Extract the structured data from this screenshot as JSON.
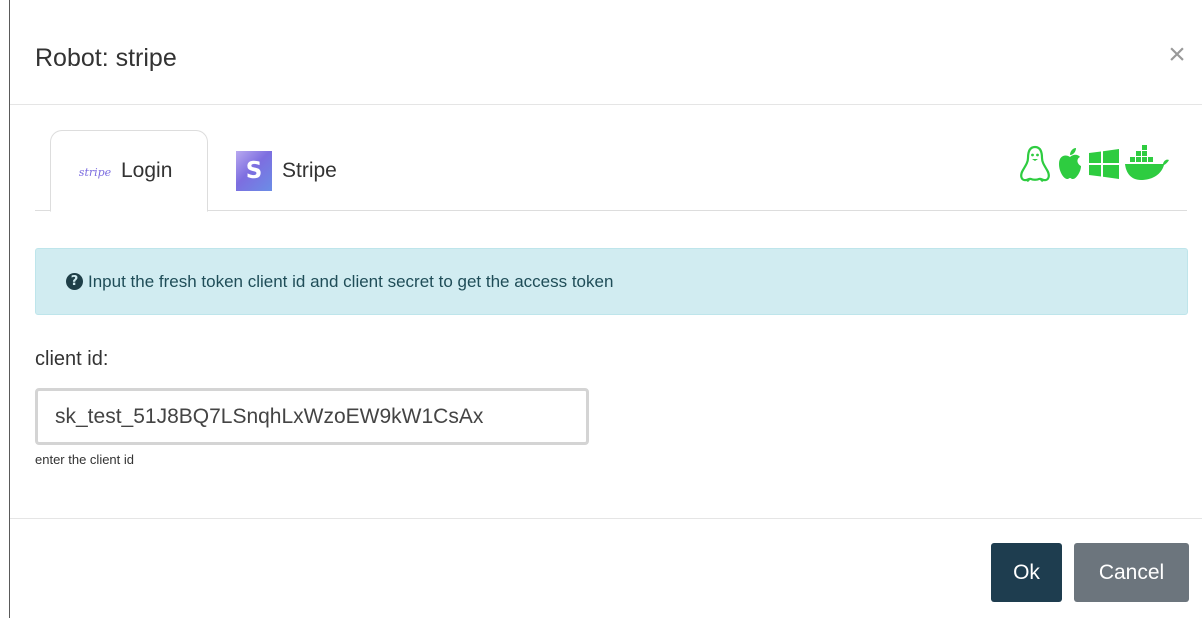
{
  "dialog": {
    "title": "Robot: stripe"
  },
  "tabs": [
    {
      "label": "Login",
      "icon": "stripe-wordmark-icon",
      "active": true
    },
    {
      "label": "Stripe",
      "icon": "stripe-s-logo-icon",
      "active": false
    }
  ],
  "platforms": {
    "color": "#2ecc40",
    "icons": [
      "linux-icon",
      "apple-icon",
      "windows-icon",
      "docker-icon"
    ]
  },
  "alert": {
    "icon": "question-circle-icon",
    "text": "Input the fresh token client id and client secret to get the access token",
    "background": "#d1ecf1"
  },
  "form": {
    "client_id_label": "client id:",
    "client_id_value": "sk_test_51J8BQ7LSnqhLxWzoEW9kW1CsAx",
    "client_id_help": "enter the client id"
  },
  "footer": {
    "ok_label": "Ok",
    "cancel_label": "Cancel",
    "ok_color": "#1e3d4f",
    "cancel_color": "#6c757d"
  },
  "icons": {
    "stripe_word": "stripe",
    "stripe_s": "S",
    "question": "?",
    "close": "×"
  }
}
